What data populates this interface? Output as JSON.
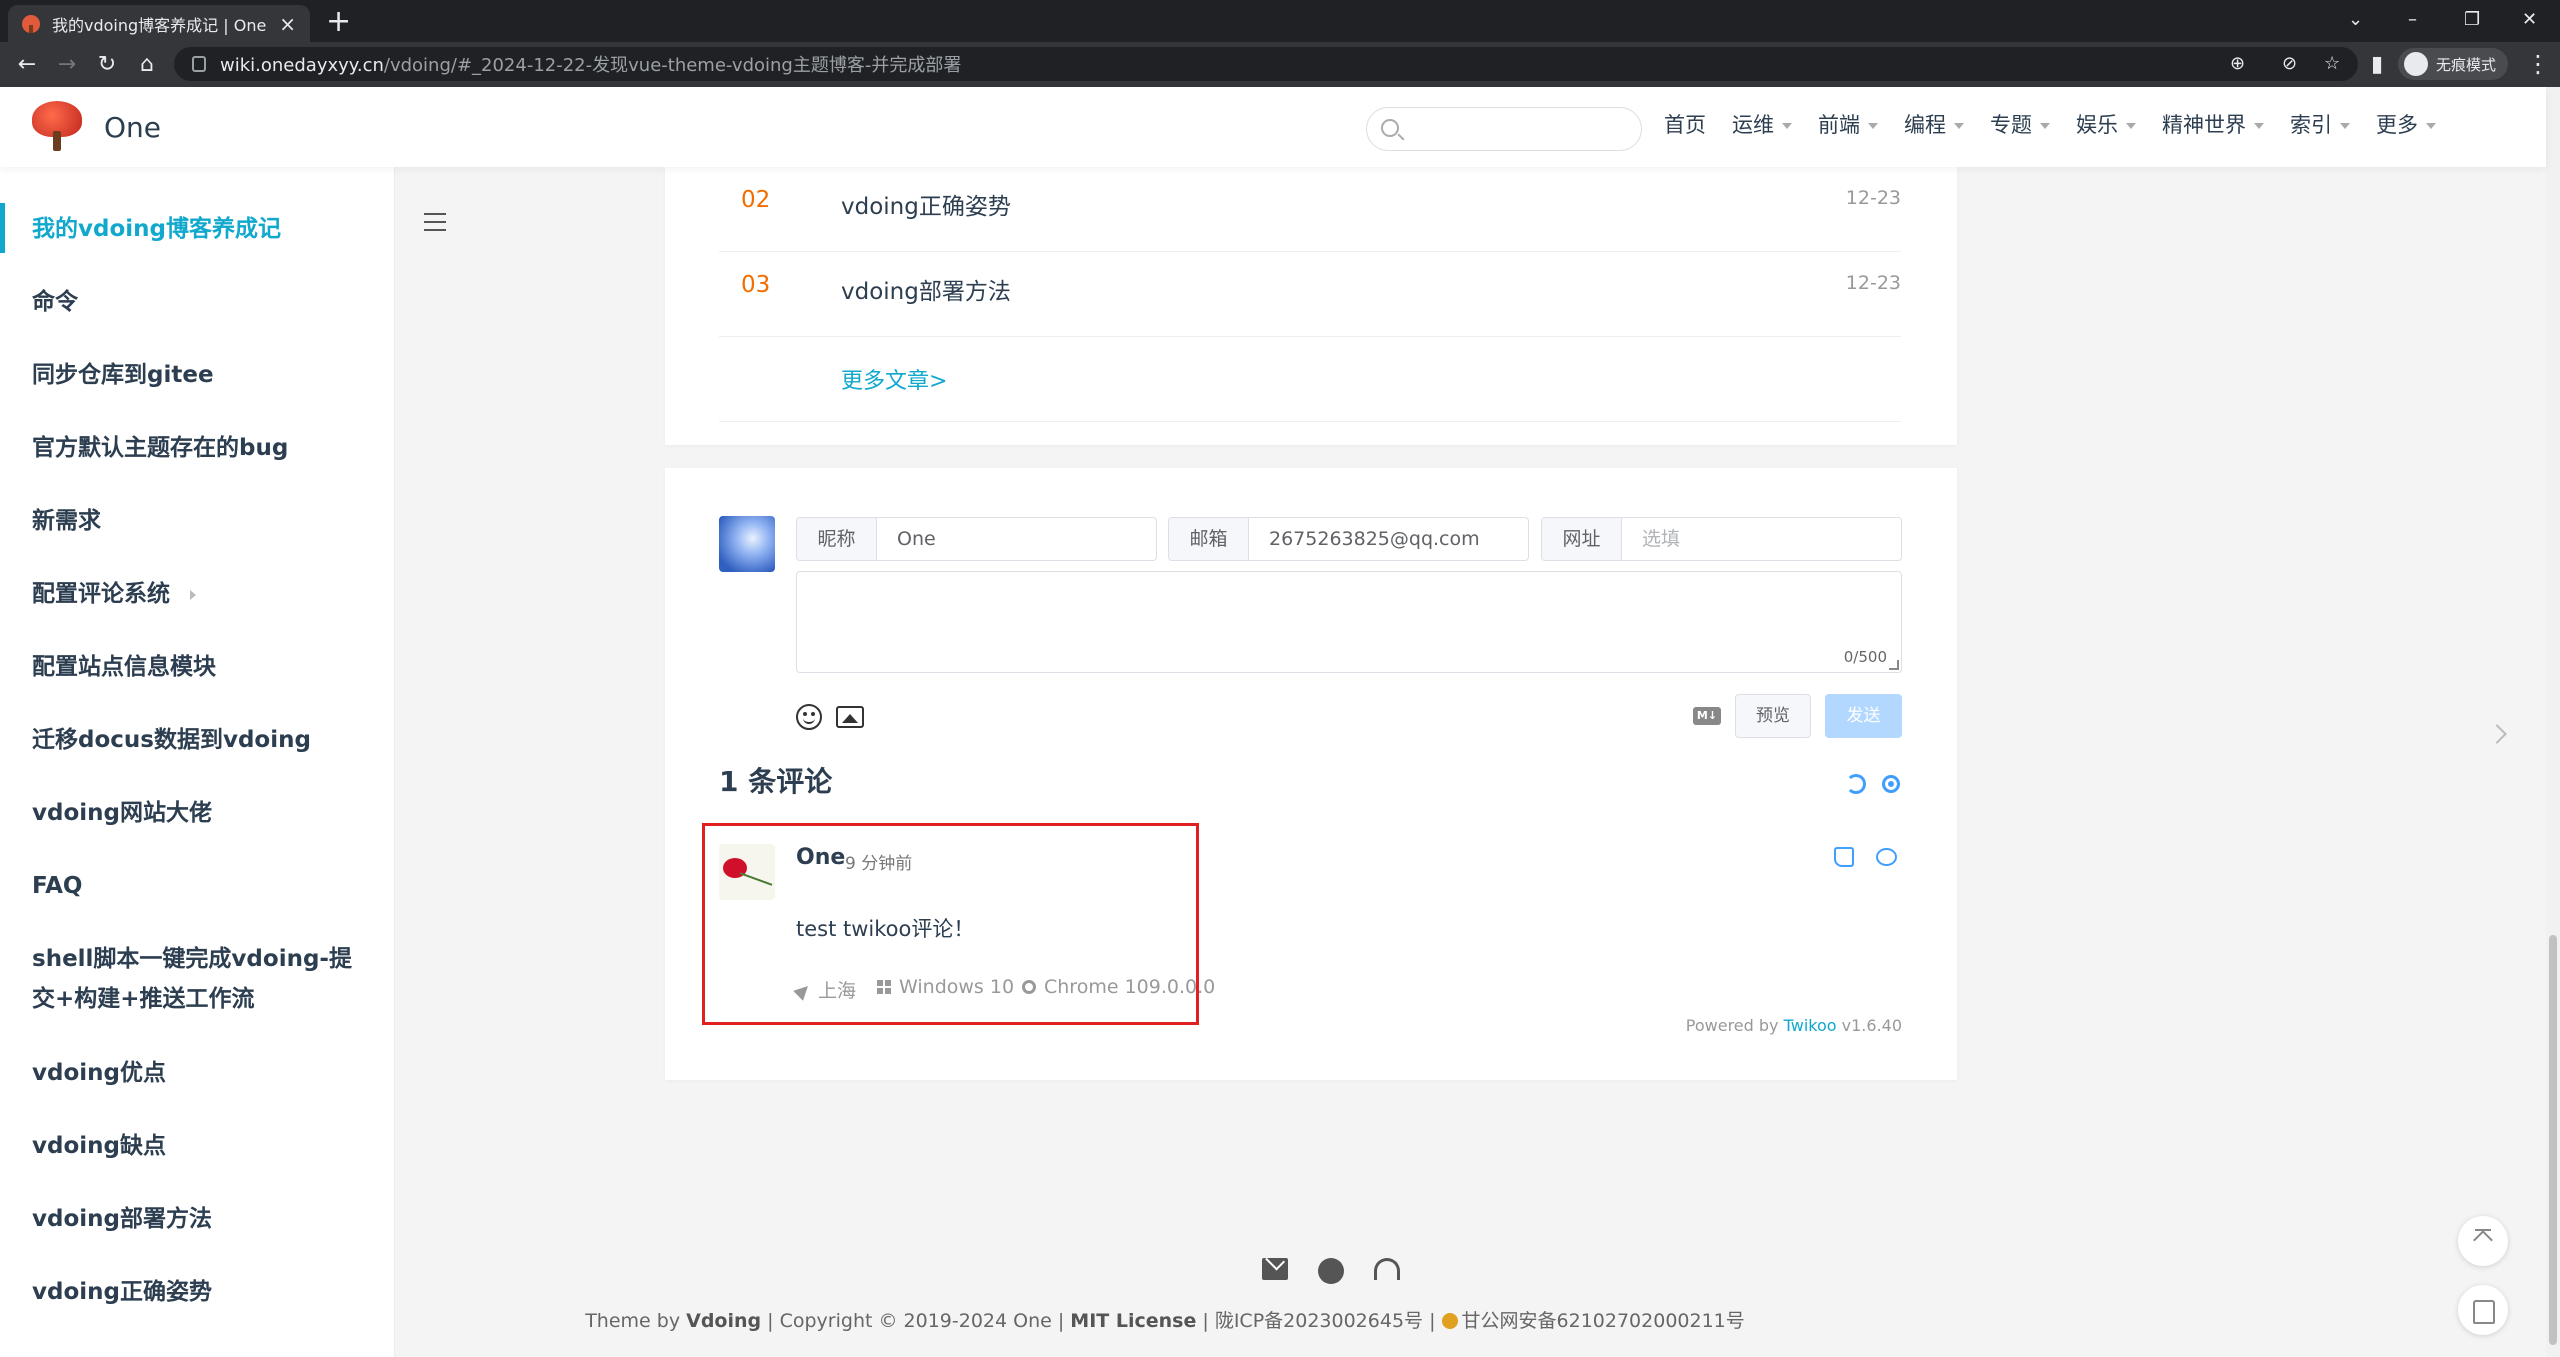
{
  "browser": {
    "tab_title": "我的vdoing博客养成记 | One",
    "new_tab": "+",
    "tab_close": "×",
    "url_host": "wiki.onedayxyy.cn",
    "url_path": "/vdoing/#_2024-12-22-发现vue-theme-vdoing主题博客-并完成部署",
    "incognito_label": "无痕模式",
    "win_minimize": "–",
    "win_restore": "❐",
    "win_close": "✕",
    "win_dropdown": "⌄"
  },
  "header": {
    "site_name": "One",
    "search_placeholder": "",
    "nav": [
      {
        "label": "首页",
        "dropdown": false
      },
      {
        "label": "运维",
        "dropdown": true
      },
      {
        "label": "前端",
        "dropdown": true
      },
      {
        "label": "编程",
        "dropdown": true
      },
      {
        "label": "专题",
        "dropdown": true
      },
      {
        "label": "娱乐",
        "dropdown": true
      },
      {
        "label": "精神世界",
        "dropdown": true
      },
      {
        "label": "索引",
        "dropdown": true
      },
      {
        "label": "更多",
        "dropdown": true
      }
    ]
  },
  "sidebar": {
    "items": [
      {
        "label": "我的vdoing博客养成记",
        "active": true
      },
      {
        "label": "命令"
      },
      {
        "label": "同步仓库到gitee"
      },
      {
        "label": "官方默认主题存在的bug"
      },
      {
        "label": "新需求"
      },
      {
        "label": "配置评论系统",
        "has_children": true
      },
      {
        "label": "配置站点信息模块"
      },
      {
        "label": "迁移docus数据到vdoing"
      },
      {
        "label": "vdoing网站大佬"
      },
      {
        "label": "FAQ"
      },
      {
        "label": "shell脚本一键完成vdoing-提交+构建+推送工作流"
      },
      {
        "label": "vdoing优点"
      },
      {
        "label": "vdoing缺点"
      },
      {
        "label": "vdoing部署方法"
      },
      {
        "label": "vdoing正确姿势"
      }
    ]
  },
  "articles": {
    "items": [
      {
        "num": "02",
        "title": "vdoing正确姿势",
        "date": "12-23"
      },
      {
        "num": "03",
        "title": "vdoing部署方法",
        "date": "12-23"
      }
    ],
    "more_label": "更多文章>"
  },
  "comment_form": {
    "nick_label": "昵称",
    "nick_value": "One",
    "mail_label": "邮箱",
    "mail_value": "2675263825@qq.com",
    "link_label": "网址",
    "link_placeholder": "选填",
    "counter": "0/500",
    "md_badge": "M↓",
    "preview_label": "预览",
    "send_label": "发送"
  },
  "comments": {
    "count_title": "1 条评论",
    "items": [
      {
        "author": "One",
        "time": "9 分钟前",
        "body": "test twikoo评论！",
        "location": "上海",
        "os": "Windows 10",
        "browser": "Chrome 109.0.0.0"
      }
    ],
    "powered_prefix": "Powered by ",
    "powered_name": "Twikoo",
    "powered_version": " v1.6.40"
  },
  "footer": {
    "theme_prefix": "Theme by ",
    "theme_name": "Vdoing",
    "copyright": " | Copyright © 2019-2024 One | ",
    "license": "MIT License",
    "icp": " | 陇ICP备2023002645号 | ",
    "police": "甘公网安备62102702000211号"
  },
  "colors": {
    "accent": "#11a8cd",
    "article_number": "#f26d00",
    "highlight_border": "#e02020",
    "link_blue": "#409eff"
  }
}
